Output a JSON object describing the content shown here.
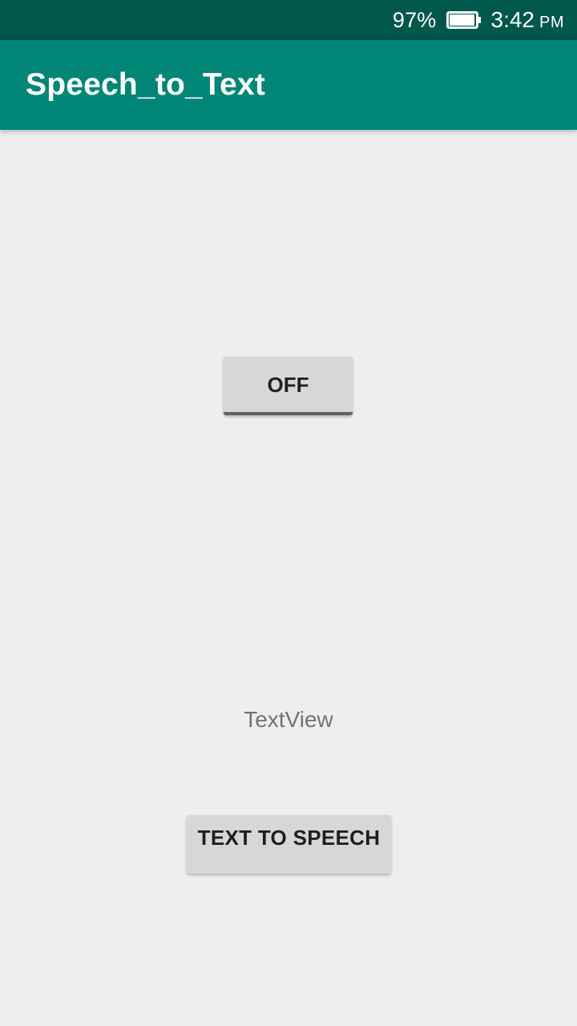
{
  "status_bar": {
    "battery_percent": "97%",
    "battery_level": 0.97,
    "battery_icon": "battery-icon",
    "time": "3:42",
    "ampm": "PM"
  },
  "app_bar": {
    "title": "Speech_to_Text"
  },
  "main": {
    "toggle_label": "OFF",
    "text_view": "TextView",
    "tts_button_label": "TEXT TO SPEECH"
  },
  "colors": {
    "status_bar": "#00574b",
    "app_bar": "#008577",
    "background": "#eeeeee",
    "button": "#d6d7d7"
  }
}
